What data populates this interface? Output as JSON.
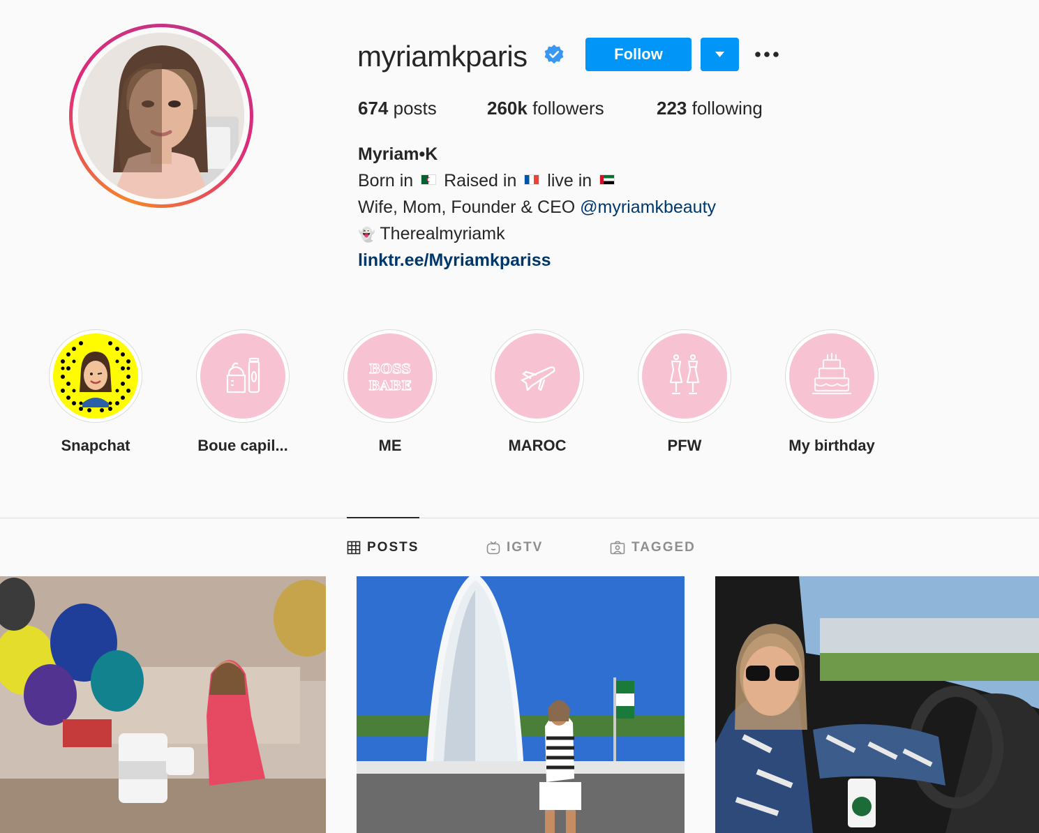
{
  "profile": {
    "username": "myriamkparis",
    "verified": true,
    "follow_label": "Follow",
    "stats": {
      "posts": "674",
      "posts_label": "posts",
      "followers": "260k",
      "followers_label": "followers",
      "following": "223",
      "following_label": "following"
    },
    "bio": {
      "name": "Myriam•K",
      "born_text": "Born in",
      "raised_text": "Raised in",
      "live_text": "live in",
      "roles_text": "Wife, Mom, Founder & CEO",
      "mention": "@myriamkbeauty",
      "snapchat_emoji": "👻",
      "snapchat_text": "Therealmyriamk",
      "link": "linktr.ee/Myriamkpariss"
    }
  },
  "highlights": [
    {
      "label": "Snapchat"
    },
    {
      "label": "Boue capil..."
    },
    {
      "label": "ME",
      "cover_text": "BOSS BABE"
    },
    {
      "label": "MAROC"
    },
    {
      "label": "PFW"
    },
    {
      "label": "My birthday"
    }
  ],
  "tabs": [
    {
      "label": "POSTS",
      "icon": "grid-icon",
      "active": true
    },
    {
      "label": "IGTV",
      "icon": "igtv-icon",
      "active": false
    },
    {
      "label": "TAGGED",
      "icon": "tagged-icon",
      "active": false
    }
  ],
  "colors": {
    "accent": "#0095f6",
    "link": "#00376b",
    "highlight_pink": "#f7c3d2",
    "text": "#262626",
    "muted": "#8e8e8e"
  }
}
